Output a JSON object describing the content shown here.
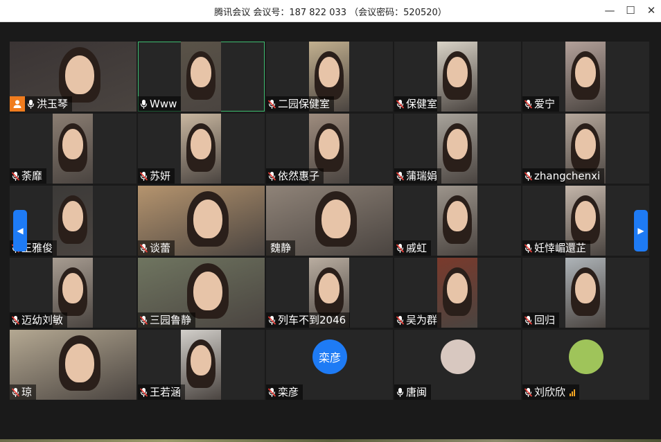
{
  "window": {
    "title": "腾讯会议 会议号：187 822 033 （会议密码：520520）",
    "minimize_glyph": "—",
    "maximize_glyph": "☐",
    "close_glyph": "✕"
  },
  "nav": {
    "prev_glyph": "◀",
    "next_glyph": "▶"
  },
  "participants": [
    {
      "name": "洪玉琴",
      "host": true,
      "mic": "on",
      "video": "full",
      "bg": "#3a3434"
    },
    {
      "name": "Www",
      "mic": "on",
      "video": "narrow",
      "bg": "#5a5348",
      "active": true
    },
    {
      "name": "二园保健室",
      "mic": "muted",
      "video": "narrow",
      "bg": "#c2b08f"
    },
    {
      "name": "保健室",
      "mic": "muted",
      "video": "narrow",
      "bg": "#d9d3c7"
    },
    {
      "name": "爱宁",
      "mic": "muted",
      "video": "narrow",
      "bg": "#b3a19a"
    },
    {
      "name": "荼靡",
      "mic": "muted",
      "video": "narrow",
      "bg": "#8a7d72"
    },
    {
      "name": "苏妍",
      "mic": "muted",
      "video": "narrow",
      "bg": "#c9b7a0"
    },
    {
      "name": "依然惠子",
      "mic": "muted",
      "video": "narrow",
      "bg": "#9e8c7e"
    },
    {
      "name": "蒲瑞娟",
      "mic": "muted",
      "video": "narrow",
      "bg": "#a8a39b"
    },
    {
      "name": "zhangchenxi",
      "mic": "muted",
      "video": "narrow",
      "bg": "#b6a89c"
    },
    {
      "name": "王雅俊",
      "mic": "muted",
      "video": "narrow",
      "bg": "#3c3a38"
    },
    {
      "name": "谈蕾",
      "mic": "muted",
      "video": "full",
      "bg": "#b5946e"
    },
    {
      "name": "魏静",
      "mic": "none",
      "video": "full",
      "bg": "#8f8378"
    },
    {
      "name": "戚虹",
      "mic": "muted",
      "video": "narrow",
      "bg": "#9c948b"
    },
    {
      "name": "妊悻嵋還芷",
      "mic": "muted",
      "video": "narrow",
      "bg": "#c4b6aa"
    },
    {
      "name": "迈幼刘敏",
      "mic": "muted",
      "video": "narrow",
      "bg": "#a79c91"
    },
    {
      "name": "三园鲁静",
      "mic": "muted",
      "video": "full",
      "bg": "#6f7560"
    },
    {
      "name": "列车不到2046",
      "mic": "muted",
      "video": "narrow",
      "bg": "#b9ada0"
    },
    {
      "name": "吴为群",
      "mic": "muted",
      "video": "narrow",
      "bg": "#7a3a2c"
    },
    {
      "name": "回归",
      "mic": "muted",
      "video": "narrow",
      "bg": "#aeb4b8"
    },
    {
      "name": "琼",
      "mic": "muted",
      "video": "full",
      "bg": "#b4a892"
    },
    {
      "name": "王若涵",
      "mic": "muted",
      "video": "narrow",
      "bg": "#d2cfca"
    },
    {
      "name": "栾彦",
      "mic": "muted",
      "video": "avatar",
      "avatar_text": "栾彦",
      "avatar_color": "#1e7bf5"
    },
    {
      "name": "唐闽",
      "mic": "on",
      "video": "avatar",
      "avatar_text": "",
      "avatar_color": "#d8c8c0"
    },
    {
      "name": "刘欣欣",
      "mic": "muted",
      "video": "avatar",
      "avatar_text": "",
      "avatar_color": "#9fc45a",
      "signal": true
    }
  ]
}
